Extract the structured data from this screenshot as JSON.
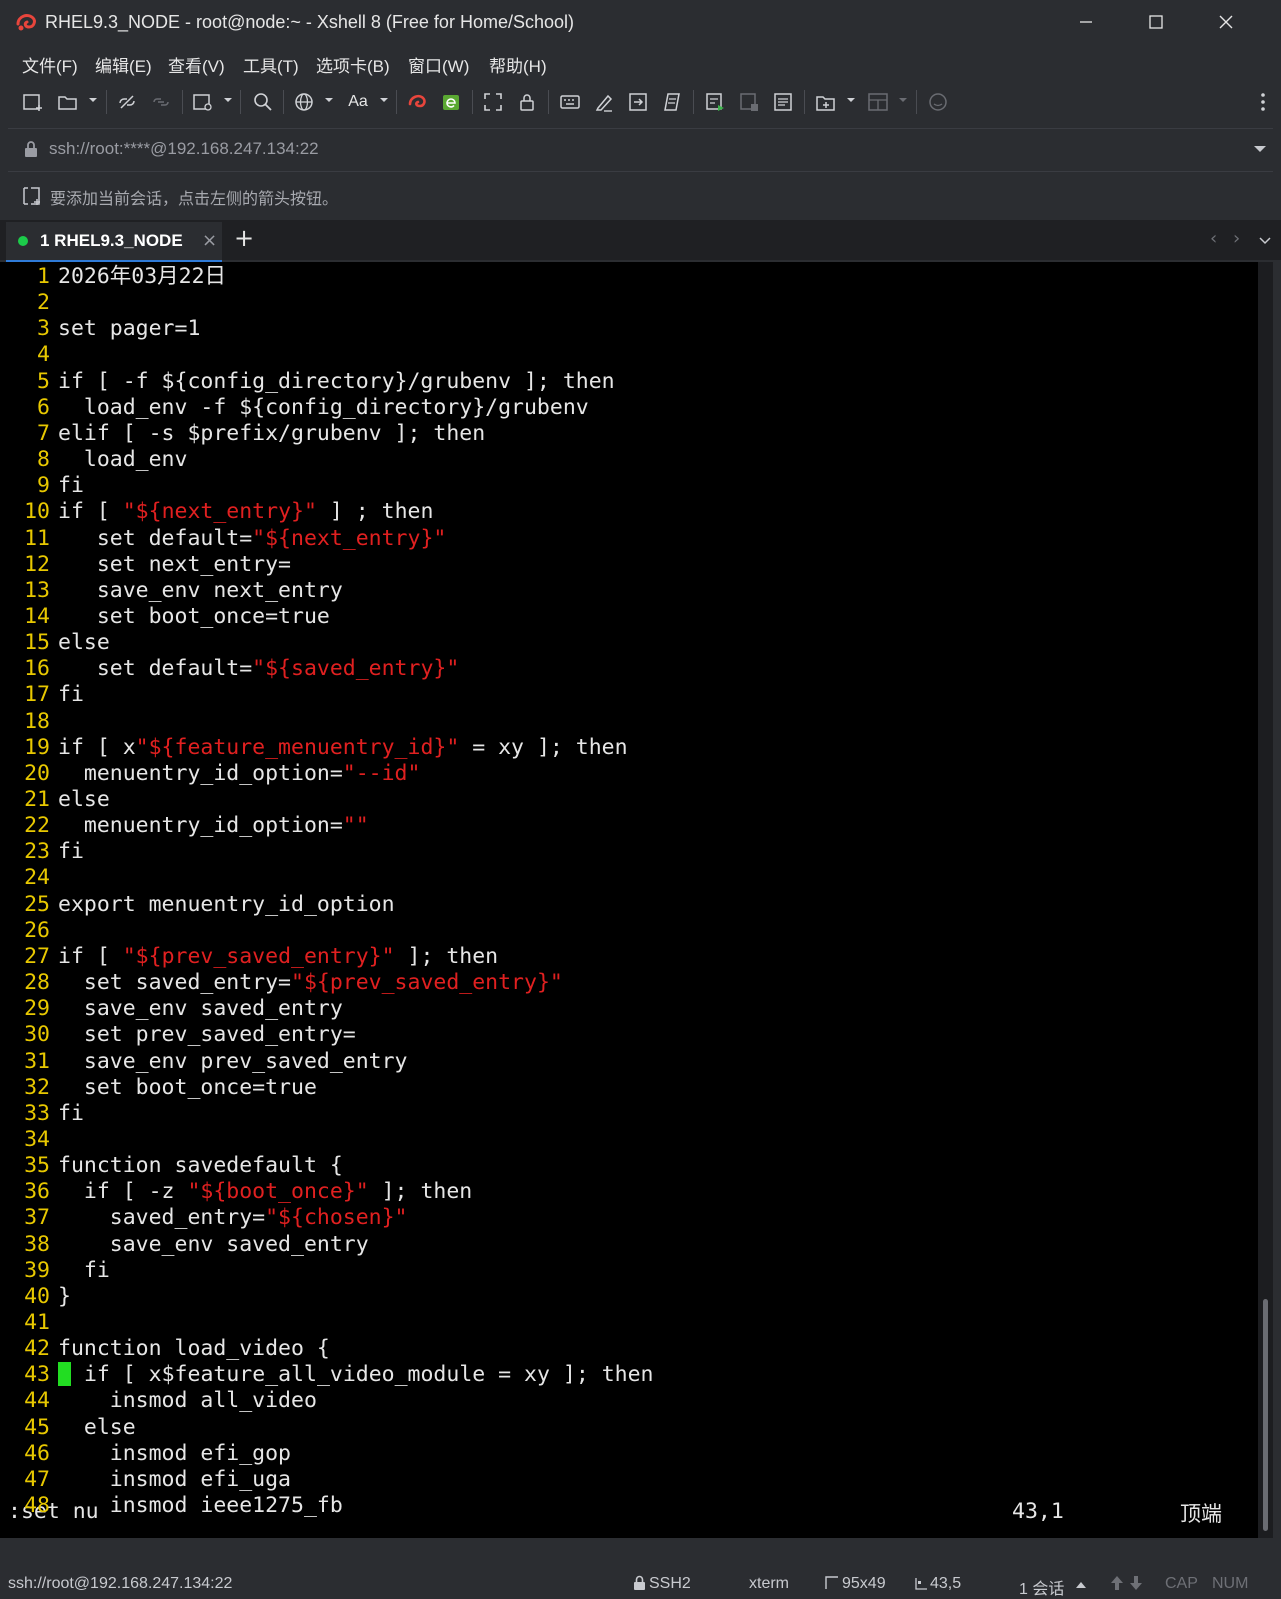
{
  "window": {
    "title": "RHEL9.3_NODE - root@node:~ - Xshell 8 (Free for Home/School)"
  },
  "menu": [
    {
      "label": "文件(F)"
    },
    {
      "label": "编辑(E)"
    },
    {
      "label": "查看(V)"
    },
    {
      "label": "工具(T)"
    },
    {
      "label": "选项卡(B)"
    },
    {
      "label": "窗口(W)"
    },
    {
      "label": "帮助(H)"
    }
  ],
  "toolbar": {
    "font_label": "Aa"
  },
  "address": {
    "url": "ssh://root:****@192.168.247.134:22"
  },
  "hint": {
    "text": "要添加当前会话，点击左侧的箭头按钮。"
  },
  "tab": {
    "label": "1 RHEL9.3_NODE",
    "close": "×",
    "add": "+",
    "status_color": "#1ccb4a"
  },
  "terminal": {
    "lines": [
      {
        "n": "1",
        "parts": [
          {
            "t": "2026年03月22日"
          }
        ]
      },
      {
        "n": "2",
        "parts": []
      },
      {
        "n": "3",
        "parts": [
          {
            "t": "set pager=1"
          }
        ]
      },
      {
        "n": "4",
        "parts": []
      },
      {
        "n": "5",
        "parts": [
          {
            "t": "if [ -f ${config_directory}/grubenv ]; then"
          }
        ]
      },
      {
        "n": "6",
        "parts": [
          {
            "t": "  load_env -f ${config_directory}/grubenv"
          }
        ]
      },
      {
        "n": "7",
        "parts": [
          {
            "t": "elif [ -s $prefix/grubenv ]; then"
          }
        ]
      },
      {
        "n": "8",
        "parts": [
          {
            "t": "  load_env"
          }
        ]
      },
      {
        "n": "9",
        "parts": [
          {
            "t": "fi"
          }
        ]
      },
      {
        "n": "10",
        "parts": [
          {
            "t": "if [ "
          },
          {
            "t": "\"${next_entry}\"",
            "s": 1
          },
          {
            "t": " ] ; then"
          }
        ]
      },
      {
        "n": "11",
        "parts": [
          {
            "t": "   set default="
          },
          {
            "t": "\"${next_entry}\"",
            "s": 1
          }
        ]
      },
      {
        "n": "12",
        "parts": [
          {
            "t": "   set next_entry="
          }
        ]
      },
      {
        "n": "13",
        "parts": [
          {
            "t": "   save_env next_entry"
          }
        ]
      },
      {
        "n": "14",
        "parts": [
          {
            "t": "   set boot_once=true"
          }
        ]
      },
      {
        "n": "15",
        "parts": [
          {
            "t": "else"
          }
        ]
      },
      {
        "n": "16",
        "parts": [
          {
            "t": "   set default="
          },
          {
            "t": "\"${saved_entry}\"",
            "s": 1
          }
        ]
      },
      {
        "n": "17",
        "parts": [
          {
            "t": "fi"
          }
        ]
      },
      {
        "n": "18",
        "parts": []
      },
      {
        "n": "19",
        "parts": [
          {
            "t": "if [ x"
          },
          {
            "t": "\"${feature_menuentry_id}\"",
            "s": 1
          },
          {
            "t": " = xy ]; then"
          }
        ]
      },
      {
        "n": "20",
        "parts": [
          {
            "t": "  menuentry_id_option="
          },
          {
            "t": "\"--id\"",
            "s": 1
          }
        ]
      },
      {
        "n": "21",
        "parts": [
          {
            "t": "else"
          }
        ]
      },
      {
        "n": "22",
        "parts": [
          {
            "t": "  menuentry_id_option="
          },
          {
            "t": "\"\"",
            "s": 1
          }
        ]
      },
      {
        "n": "23",
        "parts": [
          {
            "t": "fi"
          }
        ]
      },
      {
        "n": "24",
        "parts": []
      },
      {
        "n": "25",
        "parts": [
          {
            "t": "export menuentry_id_option"
          }
        ]
      },
      {
        "n": "26",
        "parts": []
      },
      {
        "n": "27",
        "parts": [
          {
            "t": "if [ "
          },
          {
            "t": "\"${prev_saved_entry}\"",
            "s": 1
          },
          {
            "t": " ]; then"
          }
        ]
      },
      {
        "n": "28",
        "parts": [
          {
            "t": "  set saved_entry="
          },
          {
            "t": "\"${prev_saved_entry}\"",
            "s": 1
          }
        ]
      },
      {
        "n": "29",
        "parts": [
          {
            "t": "  save_env saved_entry"
          }
        ]
      },
      {
        "n": "30",
        "parts": [
          {
            "t": "  set prev_saved_entry="
          }
        ]
      },
      {
        "n": "31",
        "parts": [
          {
            "t": "  save_env prev_saved_entry"
          }
        ]
      },
      {
        "n": "32",
        "parts": [
          {
            "t": "  set boot_once=true"
          }
        ]
      },
      {
        "n": "33",
        "parts": [
          {
            "t": "fi"
          }
        ]
      },
      {
        "n": "34",
        "parts": []
      },
      {
        "n": "35",
        "parts": [
          {
            "t": "function savedefault {"
          }
        ]
      },
      {
        "n": "36",
        "parts": [
          {
            "t": "  if [ -z "
          },
          {
            "t": "\"${boot_once}\"",
            "s": 1
          },
          {
            "t": " ]; then"
          }
        ]
      },
      {
        "n": "37",
        "parts": [
          {
            "t": "    saved_entry="
          },
          {
            "t": "\"${chosen}\"",
            "s": 1
          }
        ]
      },
      {
        "n": "38",
        "parts": [
          {
            "t": "    save_env saved_entry"
          }
        ]
      },
      {
        "n": "39",
        "parts": [
          {
            "t": "  fi"
          }
        ]
      },
      {
        "n": "40",
        "parts": [
          {
            "t": "}"
          }
        ]
      },
      {
        "n": "41",
        "parts": []
      },
      {
        "n": "42",
        "parts": [
          {
            "t": "function load_video {"
          }
        ]
      },
      {
        "n": "43",
        "cursor": true,
        "parts": [
          {
            "t": " if [ x$feature_all_video_module = xy ]; then"
          }
        ]
      },
      {
        "n": "44",
        "parts": [
          {
            "t": "    insmod all_video"
          }
        ]
      },
      {
        "n": "45",
        "parts": [
          {
            "t": "  else"
          }
        ]
      },
      {
        "n": "46",
        "parts": [
          {
            "t": "    insmod efi_gop"
          }
        ]
      },
      {
        "n": "47",
        "parts": [
          {
            "t": "    insmod efi_uga"
          }
        ]
      },
      {
        "n": "48",
        "parts": [
          {
            "t": "    insmod ieee1275_fb"
          }
        ]
      }
    ],
    "command": ":set nu",
    "position": "43,1",
    "top_label": "顶端"
  },
  "status": {
    "address": "ssh://root@192.168.247.134:22",
    "protocol": "SSH2",
    "term": "xterm",
    "size": "95x49",
    "cursor": "43,5",
    "sessions": "1 会话",
    "cap": "CAP",
    "num": "NUM"
  },
  "colors": {
    "line_number": "#e8c800",
    "string": "#e02020",
    "cursor": "#22dd22",
    "accent": "#2f7bd8"
  }
}
